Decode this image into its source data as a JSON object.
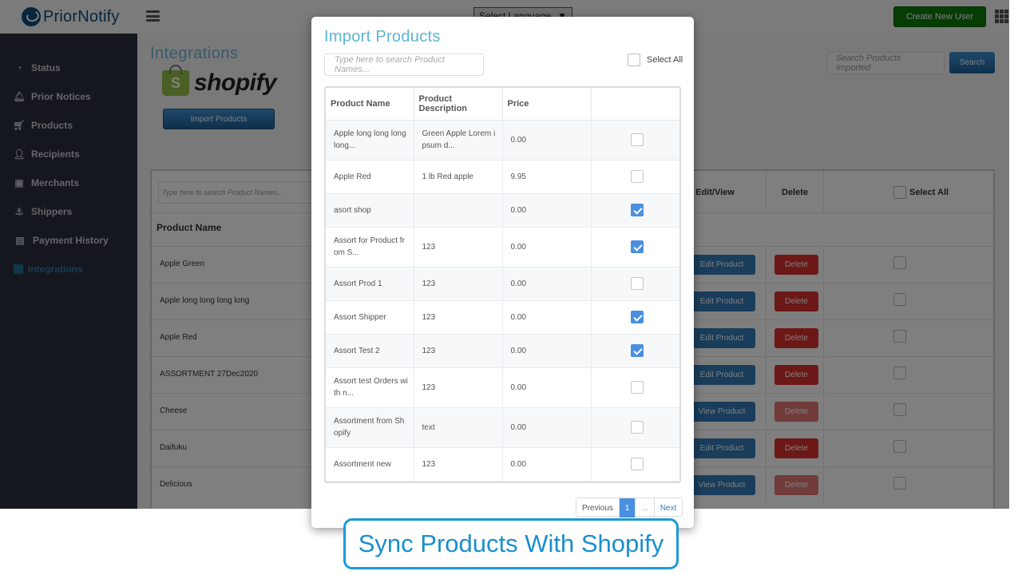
{
  "header": {
    "logo_text": "PriorNotify",
    "language_select": "Select Language",
    "create_user_label": "Create New User"
  },
  "sidebar": {
    "items": [
      {
        "label": "Status",
        "icon": "gauge-icon",
        "glyph": "◔"
      },
      {
        "label": "Prior Notices",
        "icon": "bell-icon",
        "glyph": "🔔︎"
      },
      {
        "label": "Products",
        "icon": "cart-icon",
        "glyph": "🛒︎"
      },
      {
        "label": "Recipients",
        "icon": "user-icon",
        "glyph": "👤︎"
      },
      {
        "label": "Merchants",
        "icon": "briefcase-icon",
        "glyph": "▣"
      },
      {
        "label": "Shippers",
        "icon": "anchor-icon",
        "glyph": "⚓︎"
      },
      {
        "label": "Payment History",
        "icon": "card-icon",
        "glyph": "▤"
      },
      {
        "label": "Integrations",
        "icon": "square-icon",
        "glyph": ""
      }
    ]
  },
  "main": {
    "title": "Integrations",
    "shopify_wordmark": "shopify",
    "shopify_bag_letter": "S",
    "import_button": "Import Products",
    "search_imported_placeholder": "Search Products Imported",
    "search_button": "Search",
    "table": {
      "search_placeholder": "Type here to search Product Names...",
      "headers": {
        "product_name": "Product Name",
        "edit_view": "Edit/View",
        "delete": "Delete",
        "select_all": "Select All"
      },
      "rows": [
        {
          "name": "Apple Green",
          "action": "Edit Product",
          "delete": "Delete",
          "delete_enabled": true
        },
        {
          "name": "Apple long long long long",
          "action": "Edit Product",
          "delete": "Delete",
          "delete_enabled": true
        },
        {
          "name": "Apple Red",
          "action": "Edit Product",
          "delete": "Delete",
          "delete_enabled": true
        },
        {
          "name": "ASSORTMENT 27Dec2020",
          "action": "Edit Product",
          "delete": "Delete",
          "delete_enabled": true
        },
        {
          "name": "Cheese",
          "action": "View Product",
          "delete": "Delete",
          "delete_enabled": false
        },
        {
          "name": "Daifuku",
          "action": "Edit Product",
          "delete": "Delete",
          "delete_enabled": true
        },
        {
          "name": "Delicious",
          "action": "View Product",
          "delete": "Delete",
          "delete_enabled": false
        }
      ]
    }
  },
  "modal": {
    "title": "Import Products",
    "search_placeholder": "Type here to search Product Names...",
    "select_all_label": "Select All",
    "columns": [
      "Product Name",
      "Product Description",
      "Price",
      ""
    ],
    "rows": [
      {
        "name": "Apple long long long long...",
        "description": "Green Apple Lorem i psum d...",
        "price": "0.00",
        "checked": false
      },
      {
        "name": "Apple Red",
        "description": "1 lb Red apple",
        "price": "9.95",
        "checked": false
      },
      {
        "name": "asort shop",
        "description": "",
        "price": "0.00",
        "checked": true
      },
      {
        "name": "Assort for Product fr om S...",
        "description": "123",
        "price": "0.00",
        "checked": true
      },
      {
        "name": "Assort Prod 1",
        "description": "123",
        "price": "0.00",
        "checked": false
      },
      {
        "name": "Assort Shipper",
        "description": "123",
        "price": "0.00",
        "checked": true
      },
      {
        "name": "Assort Test 2",
        "description": "123",
        "price": "0.00",
        "checked": true
      },
      {
        "name": "Assort test Orders wi th n...",
        "description": "123",
        "price": "0.00",
        "checked": false
      },
      {
        "name": "Assortment from Sh opify",
        "description": "text",
        "price": "0.00",
        "checked": false
      },
      {
        "name": "Assortment new",
        "description": "123",
        "price": "0.00",
        "checked": false
      }
    ],
    "pagination": {
      "previous": "Previous",
      "current": "1",
      "ellipsis": "...",
      "next": "Next"
    }
  },
  "caption": "Sync Products With Shopify"
}
